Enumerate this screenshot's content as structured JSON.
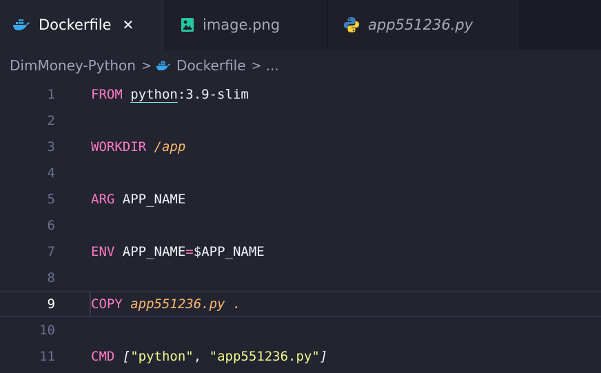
{
  "tabs": [
    {
      "label": "Dockerfile",
      "icon": "docker-icon",
      "active": true,
      "closable": true,
      "close_glyph": "✕"
    },
    {
      "label": "image.png",
      "icon": "image-file-icon",
      "active": false
    },
    {
      "label": "app551236.py",
      "icon": "python-icon",
      "active": false,
      "italic": true
    }
  ],
  "breadcrumb": {
    "folder": "DimMoney-Python",
    "file": "Dockerfile",
    "ellipsis": "...",
    "separator": ">"
  },
  "editor": {
    "current_line": 9,
    "lines": [
      {
        "number": "1",
        "keyword": "FROM",
        "image": "python",
        "tag": ":3.9-slim"
      },
      {
        "number": "2"
      },
      {
        "number": "3",
        "keyword": "WORKDIR",
        "path": "/app"
      },
      {
        "number": "4"
      },
      {
        "number": "5",
        "keyword": "ARG",
        "arg": "APP_NAME"
      },
      {
        "number": "6"
      },
      {
        "number": "7",
        "keyword": "ENV",
        "name": "APP_NAME",
        "eq": "=",
        "value": "$APP_NAME"
      },
      {
        "number": "8"
      },
      {
        "number": "9",
        "keyword": "COPY",
        "src": "app551236.py",
        "dest": "."
      },
      {
        "number": "10"
      },
      {
        "number": "11",
        "keyword": "CMD",
        "open": "[",
        "arg1": "\"python\"",
        "comma": ",",
        "arg2": "\"app551236.py\"",
        "close": "]"
      }
    ]
  },
  "colors": {
    "background": "#222430",
    "tab_bar": "#1a1b24",
    "keyword": "#ff79c6",
    "string": "#f1fa8c",
    "path": "#ffb86c",
    "line_number": "#6c7191"
  }
}
